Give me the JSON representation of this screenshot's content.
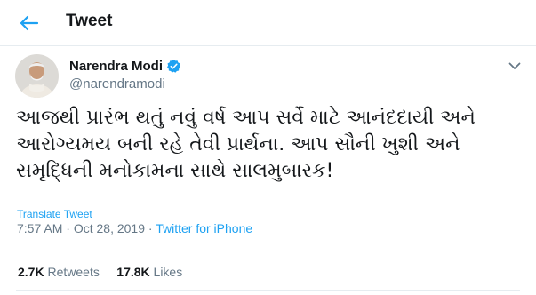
{
  "header": {
    "title": "Tweet",
    "back_icon": "arrow-left-icon"
  },
  "author": {
    "name": "Narendra Modi",
    "handle": "@narendramodi",
    "verified": true
  },
  "tweet": {
    "lines": [
      "આજથી પ્રારંભ થતું નવું વર્ષ આપ સર્વે માટે આનંદદાયી અને",
      "આરોગ્યમય બની રહે તેવી પ્રાર્થના. આપ સૌની ખુશી અને",
      "સમૃદ્ધિની મનોકામના સાથે સાલમુબારક!"
    ],
    "translate_label": "Translate Tweet",
    "time": "7:57 AM",
    "separator1": " · ",
    "date": "Oct 28, 2019",
    "separator2": " · ",
    "source": "Twitter for iPhone"
  },
  "stats": {
    "retweets_count": "2.7K",
    "retweets_label": "Retweets",
    "likes_count": "17.8K",
    "likes_label": "Likes"
  },
  "colors": {
    "accent": "#1da1f2",
    "text": "#14171a",
    "muted": "#657786",
    "border": "#e6ecf0"
  }
}
